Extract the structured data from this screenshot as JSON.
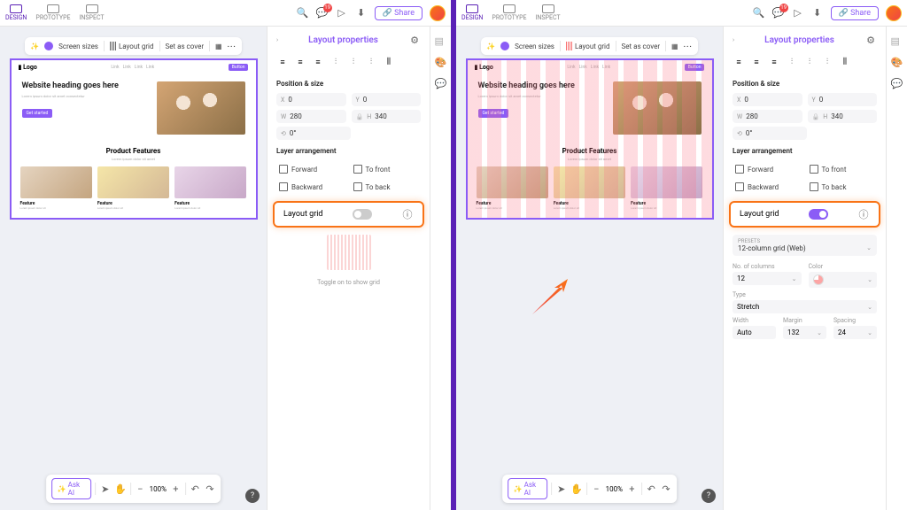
{
  "topbar": {
    "tabs": {
      "design": "DESIGN",
      "prototype": "PROTOTYPE",
      "inspect": "INSPECT"
    },
    "share": "Share",
    "notif_count": "19"
  },
  "panel": {
    "title": "Layout properties",
    "pos_label": "Position & size",
    "x": "0",
    "y": "0",
    "w": "280",
    "h": "340",
    "rot": "0°",
    "arr_label": "Layer arrangement",
    "forward": "Forward",
    "tofront": "To front",
    "backward": "Backward",
    "toback": "To back",
    "grid_label": "Layout grid",
    "hint": "Toggle on to show grid",
    "preset_label": "PRESETS",
    "preset_val": "12-column grid (Web)",
    "cols_label": "No. of columns",
    "cols_val": "12",
    "color_label": "Color",
    "type_label": "Type",
    "type_val": "Stretch",
    "width_label": "Width",
    "width_val": "Auto",
    "margin_label": "Margin",
    "margin_val": "132",
    "spacing_label": "Spacing",
    "spacing_val": "24"
  },
  "toolbar": {
    "sizes": "Screen sizes",
    "grid": "Layout grid",
    "cover": "Set as cover"
  },
  "mock": {
    "logo": "Logo",
    "hero_h": "Website heading goes here",
    "hero_p": "Lorem ipsum dolor sit amet consectetur",
    "cta": "Get started",
    "feat_title": "Product Features",
    "feat_sub": "Lorem ipsum dolor sit amet",
    "feat_t": "Feature",
    "feat_d": "Lorem ipsum dolor sit"
  },
  "bottom": {
    "askai": "Ask AI",
    "zoom": "100%"
  }
}
